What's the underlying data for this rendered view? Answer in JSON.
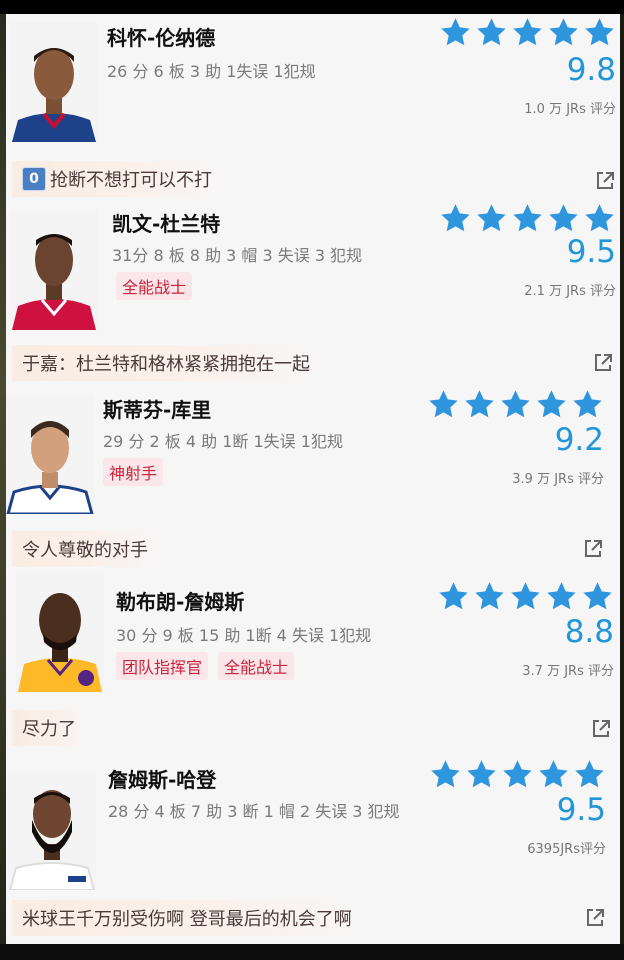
{
  "colors": {
    "star": "#2f96de",
    "score": "#2196d9",
    "tag_text": "#c8253d",
    "tag_bg": "#fbe6ea"
  },
  "players": [
    {
      "name": "科怀-伦纳德",
      "stats": "26 分 6 板 3 助 1失误 1犯规",
      "tags": [],
      "stars": 5,
      "score": "9.8",
      "ratings": "1.0 万 JRs 评分",
      "comment": "抢断不想打可以不打",
      "comment_icon": "0"
    },
    {
      "name": "凯文-杜兰特",
      "stats": "31分 8 板 8 助 3 帽 3 失误 3 犯规",
      "tags": [
        "全能战士"
      ],
      "stars": 5,
      "score": "9.5",
      "ratings": "2.1 万 JRs 评分",
      "comment": "于嘉：杜兰特和格林紧紧拥抱在一起",
      "comment_icon": ""
    },
    {
      "name": "斯蒂芬-库里",
      "stats": "29 分 2 板 4 助 1断 1失误 1犯规",
      "tags": [
        "神射手"
      ],
      "stars": 5,
      "score": "9.2",
      "ratings": "3.9 万 JRs 评分",
      "comment": "令人尊敬的对手",
      "comment_icon": ""
    },
    {
      "name": "勒布朗-詹姆斯",
      "stats": "30 分 9 板 15 助 1断 4 失误 1犯规",
      "tags": [
        "团队指挥官",
        "全能战士"
      ],
      "stars": 5,
      "score": "8.8",
      "ratings": "3.7 万 JRs 评分",
      "comment": "尽力了",
      "comment_icon": ""
    },
    {
      "name": "詹姆斯-哈登",
      "stats": "28 分 4 板 7 助 3 断 1 帽 2 失误 3 犯规",
      "tags": [],
      "stars": 5,
      "score": "9.5",
      "ratings": "6395JRs评分",
      "comment": "米球王千万别受伤啊 登哥最后的机会了啊",
      "comment_icon": ""
    }
  ]
}
